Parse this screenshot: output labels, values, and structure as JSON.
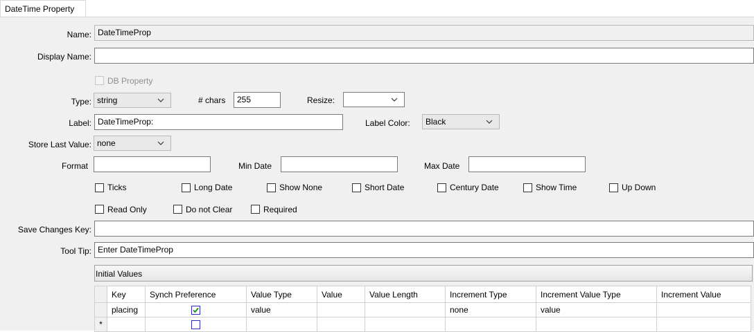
{
  "tab": {
    "label": "DateTime Property"
  },
  "fields": {
    "name": {
      "label": "Name:",
      "value": "DateTimeProp"
    },
    "display_name": {
      "label": "Display Name:",
      "value": ""
    },
    "db_property": {
      "label": "DB Property",
      "checked": false
    },
    "type": {
      "label": "Type:",
      "value": "string"
    },
    "chars": {
      "label": "# chars",
      "value": "255"
    },
    "resize": {
      "label": "Resize:",
      "value": ""
    },
    "label": {
      "label": "Label:",
      "value": "DateTimeProp:"
    },
    "label_color": {
      "label": "Label Color:",
      "value": "Black"
    },
    "store_last_value": {
      "label": "Store Last Value:",
      "value": "none"
    },
    "format": {
      "label": "Format",
      "value": ""
    },
    "min_date": {
      "label": "Min Date",
      "value": ""
    },
    "max_date": {
      "label": "Max Date",
      "value": ""
    },
    "save_changes_key": {
      "label": "Save Changes Key:",
      "value": ""
    },
    "tool_tip": {
      "label": "Tool Tip:",
      "value": "Enter DateTimeProp"
    }
  },
  "options_row1": [
    "Ticks",
    "Long Date",
    "Show None",
    "Short Date",
    "Century Date",
    "Show Time",
    "Up Down"
  ],
  "options_row2": [
    "Read Only",
    "Do not Clear",
    "Required"
  ],
  "initial_values": {
    "title": "Initial Values",
    "columns": [
      "Key",
      "Synch Preference",
      "Value Type",
      "Value",
      "Value Length",
      "Increment Type",
      "Increment Value Type",
      "Increment Value"
    ],
    "rows": [
      {
        "key": "placing",
        "synch": true,
        "value_type": "value",
        "value": "",
        "value_length": "",
        "increment_type": "none",
        "increment_value_type": "value",
        "increment_value": ""
      }
    ],
    "new_row_marker": "*"
  },
  "colors": {
    "check_border": "#2b2bb8",
    "check_mark": "#1b8a1b",
    "panel_bg": "#f0f0f0"
  }
}
